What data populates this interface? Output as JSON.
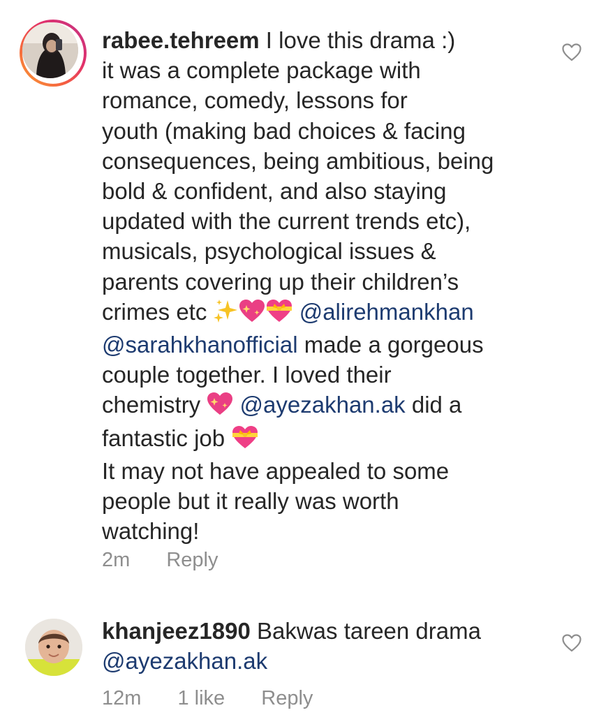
{
  "comments": [
    {
      "username": "rabee.tehreem",
      "lines": [
        [
          {
            "t": " I love this drama :)"
          }
        ],
        [
          {
            "t": "it was a complete package with"
          }
        ],
        [
          {
            "t": "romance, comedy, lessons for"
          }
        ],
        [
          {
            "t": "youth (making bad choices & facing"
          }
        ],
        [
          {
            "t": "consequences, being ambitious, being"
          }
        ],
        [
          {
            "t": "bold & confident, and also staying"
          }
        ],
        [
          {
            "t": "updated with the current trends etc),"
          }
        ],
        [
          {
            "t": "musicals, psychological issues &"
          }
        ],
        [
          {
            "t": "parents covering up their children’s"
          }
        ],
        [
          {
            "t": "crimes etc "
          },
          {
            "mention": "@alirehmankhan"
          }
        ],
        [
          {
            "mention": "@sarahkhanofficial"
          },
          {
            "t": " made a gorgeous"
          }
        ],
        [
          {
            "t": "couple together. I loved their"
          }
        ],
        [
          {
            "t": "chemistry "
          },
          {
            "mention": "@ayezakhan.ak"
          },
          {
            "t": " did a"
          }
        ],
        [
          {
            "t": "fantastic job "
          }
        ],
        [
          {
            "t": "It may not have appealed to some"
          }
        ],
        [
          {
            "t": "people but it really was worth"
          }
        ],
        [
          {
            "t": "watching!"
          }
        ]
      ],
      "time": "2m",
      "reply_label": "Reply",
      "avatar_icon": "user-avatar-story-ring"
    },
    {
      "username": "khanjeez1890",
      "lines": [
        [
          {
            "t": " Bakwas tareen drama"
          }
        ],
        [
          {
            "mention": "@ayezakhan.ak"
          }
        ]
      ],
      "time": "12m",
      "likes_label": "1 like",
      "reply_label": "Reply",
      "avatar_icon": "user-avatar"
    }
  ],
  "icons": {
    "like": "heart-outline-icon",
    "sparkles": "sparkles-emoji",
    "sparkling_heart": "sparkling-heart-emoji",
    "heart_with_ribbon": "heart-with-ribbon-emoji"
  },
  "colors": {
    "text": "#262626",
    "mention": "#1d3b70",
    "meta": "#8e8e8e",
    "story_ring_start": "#f9a034",
    "story_ring_end": "#c13584"
  }
}
